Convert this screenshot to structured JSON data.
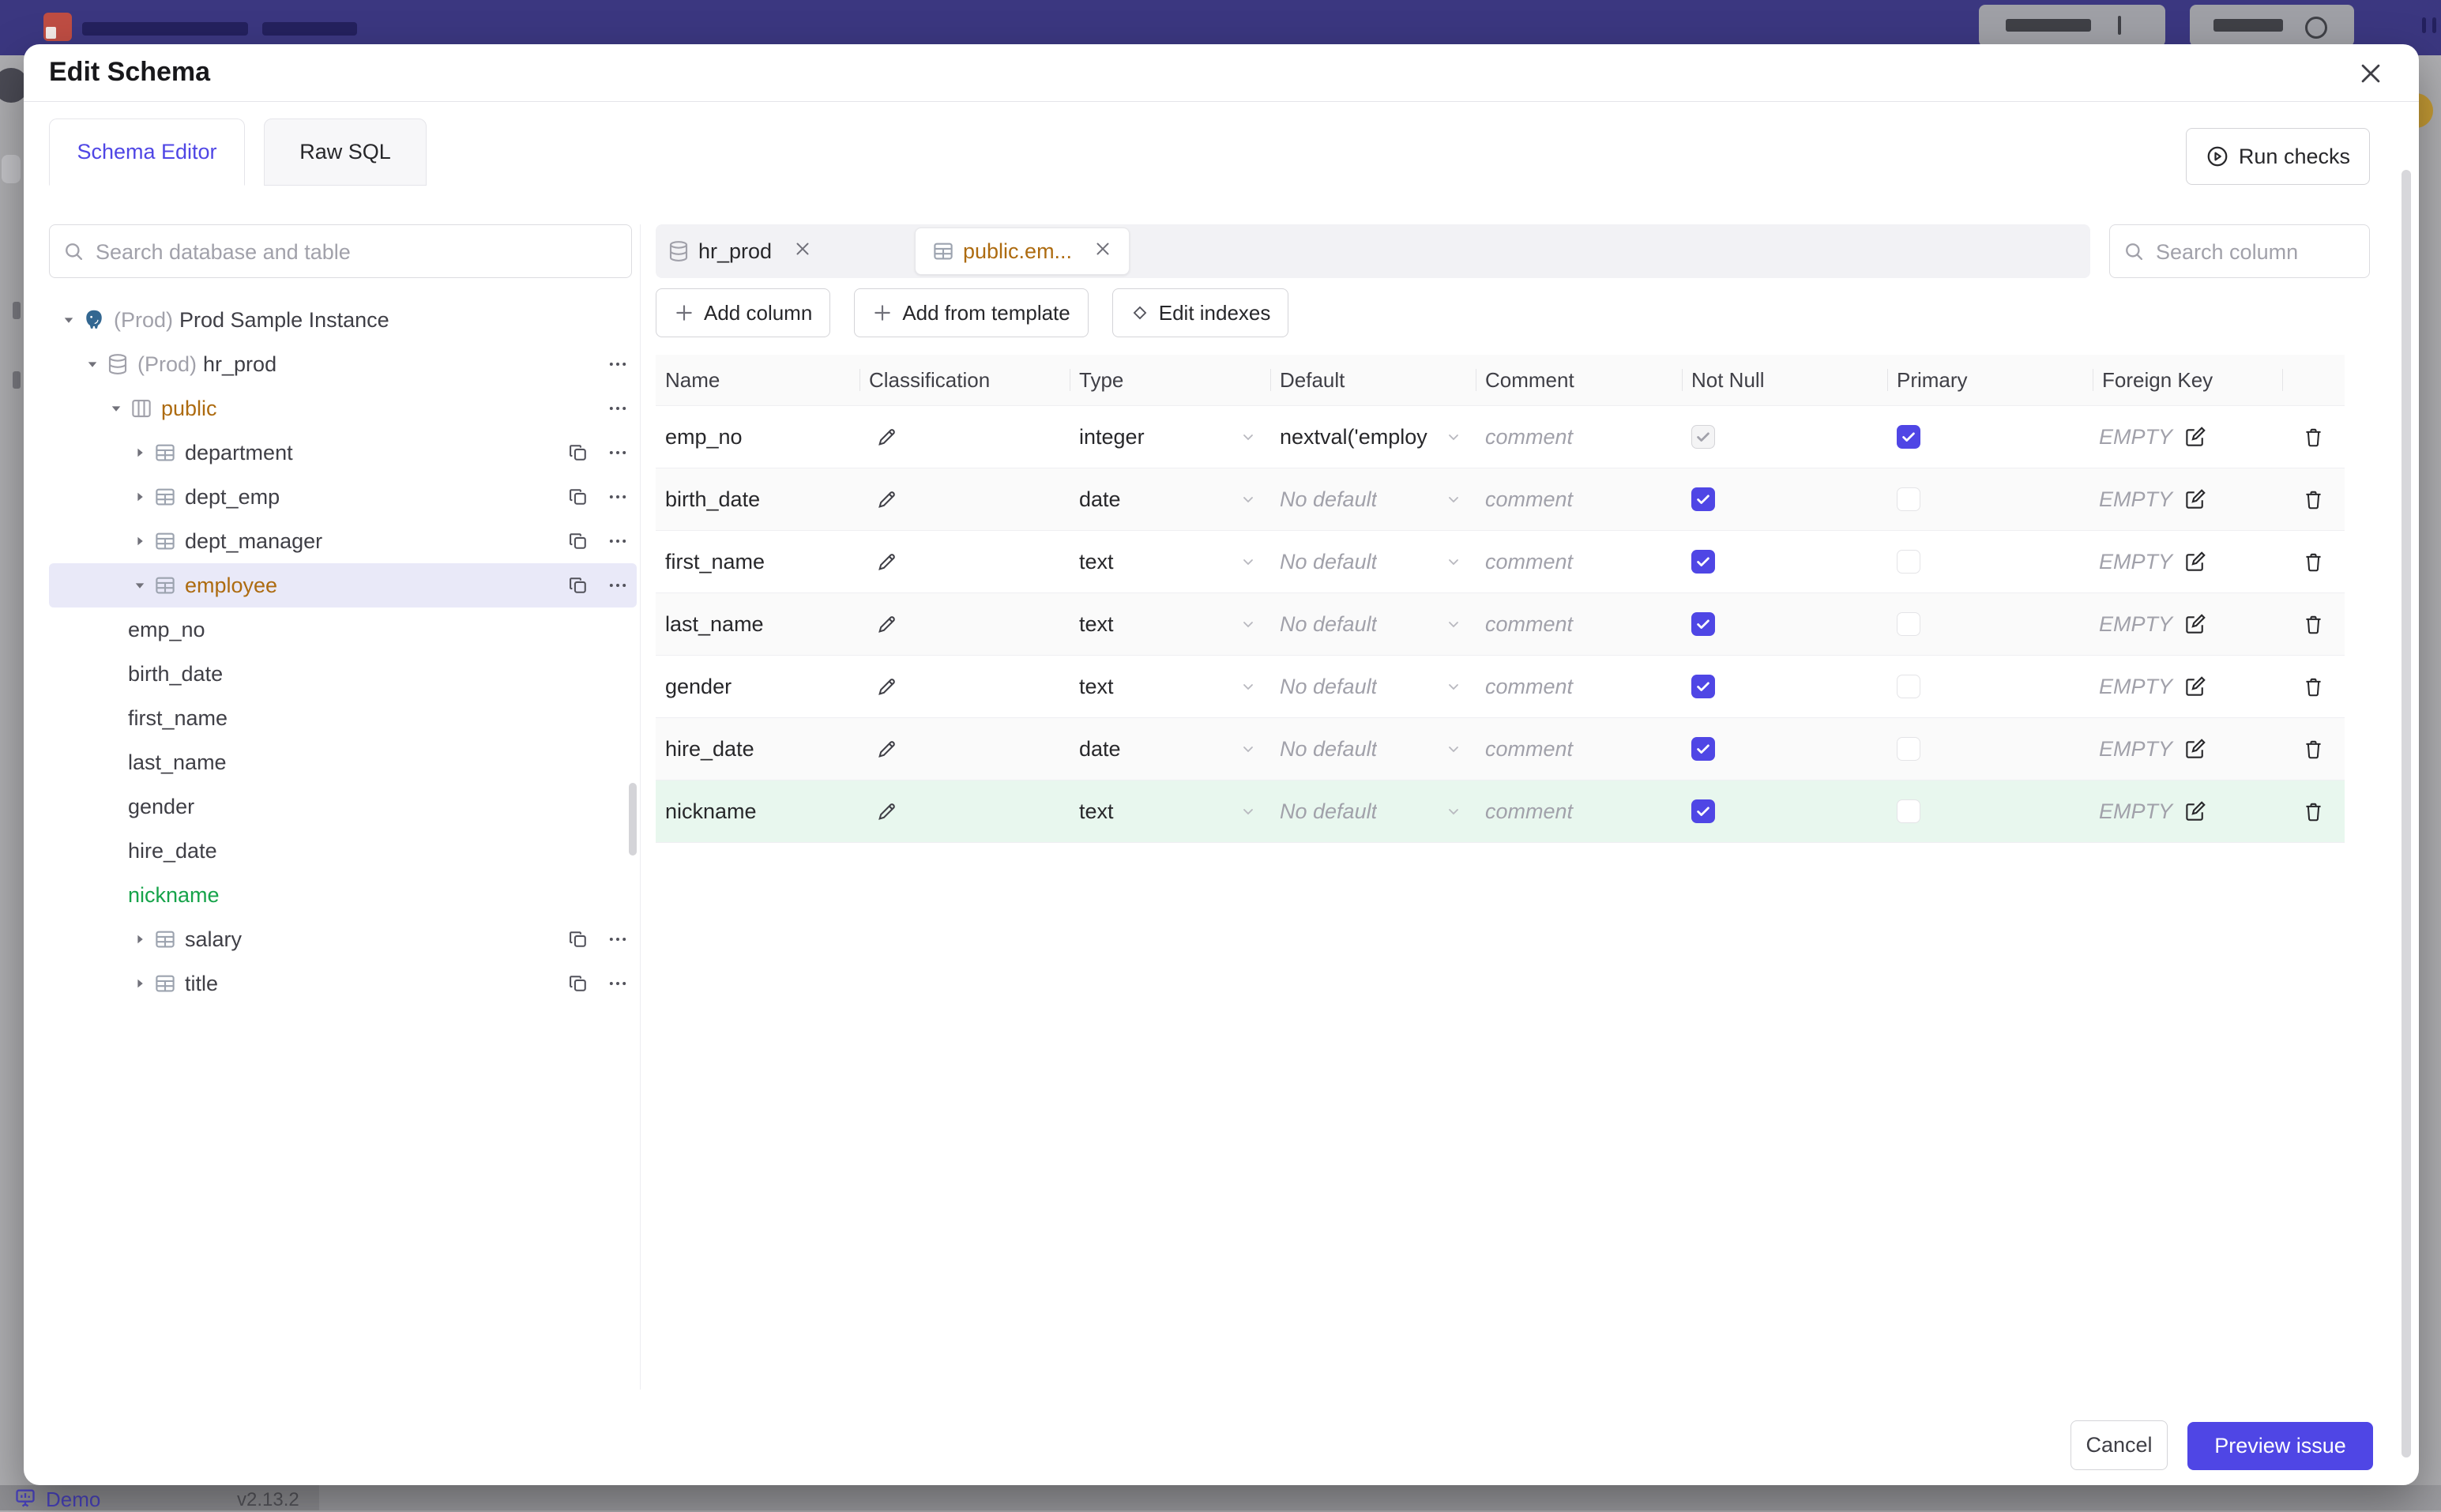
{
  "colors": {
    "accent": "#4f46e5",
    "modified_amber": "#ad6b10",
    "added_green": "#16a34a",
    "topbar": "#3b3780",
    "selected_row": "#e9e9f8",
    "added_row_bg": "#e8f7ee"
  },
  "backdrop": {
    "status": {
      "app_label": "Demo",
      "version": "v2.13.2"
    }
  },
  "modal": {
    "title": "Edit Schema",
    "close_icon": "x-icon",
    "tabs": [
      {
        "label": "Schema Editor",
        "active": true
      },
      {
        "label": "Raw SQL",
        "active": false
      }
    ],
    "run_checks_label": "Run checks",
    "sidebar": {
      "search_placeholder": "Search database and table",
      "tree": [
        {
          "level": 0,
          "caret": "down",
          "icon": "postgres",
          "prefix": "(Prod)",
          "label": "Prod Sample Instance",
          "actions": []
        },
        {
          "level": 1,
          "caret": "down",
          "icon": "database",
          "prefix": "(Prod)",
          "label": "hr_prod",
          "actions": [
            "more"
          ]
        },
        {
          "level": 2,
          "caret": "down",
          "icon": "schema",
          "label": "public",
          "color": "amber",
          "actions": [
            "more"
          ]
        },
        {
          "level": 3,
          "caret": "right",
          "icon": "table",
          "label": "department",
          "actions": [
            "copy",
            "more"
          ]
        },
        {
          "level": 3,
          "caret": "right",
          "icon": "table",
          "label": "dept_emp",
          "actions": [
            "copy",
            "more"
          ]
        },
        {
          "level": 3,
          "caret": "right",
          "icon": "table",
          "label": "dept_manager",
          "actions": [
            "copy",
            "more"
          ]
        },
        {
          "level": 3,
          "caret": "down",
          "icon": "table",
          "label": "employee",
          "color": "amber",
          "selected": true,
          "actions": [
            "copy",
            "more"
          ]
        },
        {
          "level": 4,
          "label": "emp_no",
          "actions": []
        },
        {
          "level": 4,
          "label": "birth_date",
          "actions": []
        },
        {
          "level": 4,
          "label": "first_name",
          "actions": []
        },
        {
          "level": 4,
          "label": "last_name",
          "actions": []
        },
        {
          "level": 4,
          "label": "gender",
          "actions": []
        },
        {
          "level": 4,
          "label": "hire_date",
          "actions": []
        },
        {
          "level": 4,
          "label": "nickname",
          "color": "green",
          "actions": []
        },
        {
          "level": 3,
          "caret": "right",
          "icon": "table",
          "label": "salary",
          "actions": [
            "copy",
            "more"
          ]
        },
        {
          "level": 3,
          "caret": "right",
          "icon": "table",
          "label": "title",
          "actions": [
            "copy",
            "more"
          ]
        }
      ]
    },
    "editor": {
      "open_tabs": [
        {
          "label": "hr_prod",
          "icon": "database-icon",
          "active": false
        },
        {
          "label": "public.em...",
          "icon": "table-icon",
          "active": true,
          "modified": true
        }
      ],
      "column_search_placeholder": "Search column",
      "toolbar": {
        "add_column": "Add column",
        "add_from_template": "Add from template",
        "edit_indexes": "Edit indexes"
      },
      "table": {
        "headers": [
          "Name",
          "Classification",
          "Type",
          "Default",
          "Comment",
          "Not Null",
          "Primary",
          "Foreign Key",
          ""
        ],
        "comment_placeholder": "comment",
        "foreign_key_empty": "EMPTY",
        "rows": [
          {
            "name": "emp_no",
            "type": "integer",
            "default": "nextval('employ",
            "default_is_placeholder": false,
            "not_null": {
              "checked": true,
              "disabled": true
            },
            "primary": {
              "checked": true
            },
            "added": false
          },
          {
            "name": "birth_date",
            "type": "date",
            "default": "No default",
            "default_is_placeholder": true,
            "not_null": {
              "checked": true,
              "disabled": false
            },
            "primary": {
              "checked": false
            },
            "added": false
          },
          {
            "name": "first_name",
            "type": "text",
            "default": "No default",
            "default_is_placeholder": true,
            "not_null": {
              "checked": true,
              "disabled": false
            },
            "primary": {
              "checked": false
            },
            "added": false
          },
          {
            "name": "last_name",
            "type": "text",
            "default": "No default",
            "default_is_placeholder": true,
            "not_null": {
              "checked": true,
              "disabled": false
            },
            "primary": {
              "checked": false
            },
            "added": false
          },
          {
            "name": "gender",
            "type": "text",
            "default": "No default",
            "default_is_placeholder": true,
            "not_null": {
              "checked": true,
              "disabled": false
            },
            "primary": {
              "checked": false
            },
            "added": false
          },
          {
            "name": "hire_date",
            "type": "date",
            "default": "No default",
            "default_is_placeholder": true,
            "not_null": {
              "checked": true,
              "disabled": false
            },
            "primary": {
              "checked": false
            },
            "added": false
          },
          {
            "name": "nickname",
            "type": "text",
            "default": "No default",
            "default_is_placeholder": true,
            "not_null": {
              "checked": true,
              "disabled": false
            },
            "primary": {
              "checked": false
            },
            "added": true
          }
        ]
      }
    },
    "footer": {
      "cancel_label": "Cancel",
      "submit_label": "Preview issue"
    }
  }
}
